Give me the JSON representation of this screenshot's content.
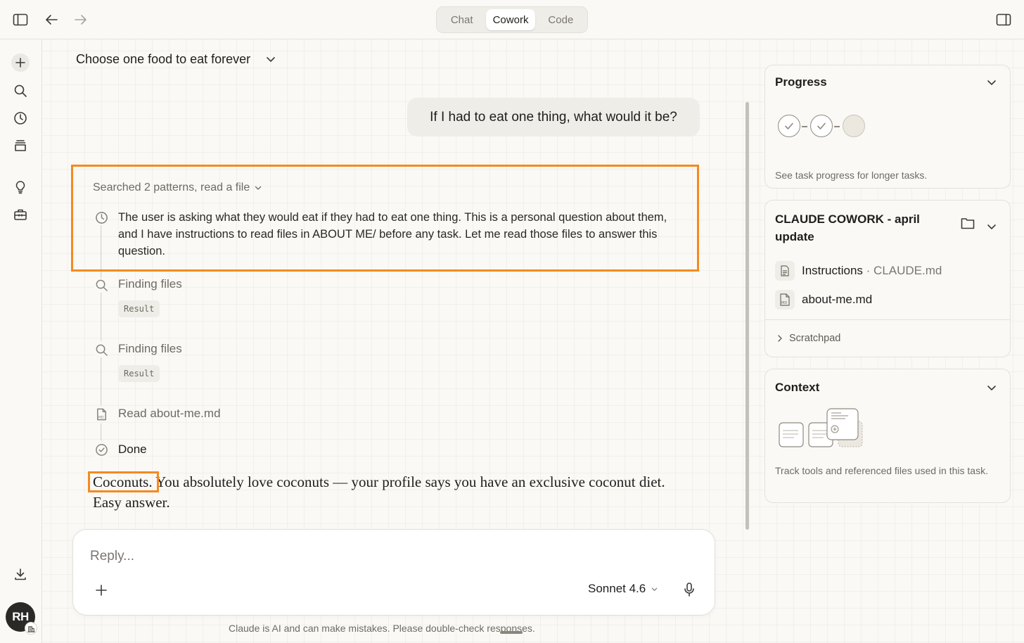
{
  "topbar": {
    "tabs": [
      {
        "label": "Chat",
        "active": false
      },
      {
        "label": "Cowork",
        "active": true
      },
      {
        "label": "Code",
        "active": false
      }
    ]
  },
  "rail": {
    "avatar_initials": "RH"
  },
  "conversation": {
    "title": "Choose one food to eat forever",
    "user_message": "If I had to eat one thing, what would it be?",
    "steps_summary": "Searched 2 patterns, read a file",
    "thinking": "The user is asking what they would eat if they had to eat one thing. This is a personal question about them, and I have instructions to read files in ABOUT ME/ before any task. Let me read those files to answer this question.",
    "steps": [
      {
        "label": "Finding files",
        "result": "Result"
      },
      {
        "label": "Finding files",
        "result": "Result"
      },
      {
        "label": "Read about-me.md"
      },
      {
        "label": "Done"
      }
    ],
    "answer_lead": "Coconuts.",
    "answer_rest": " You absolutely love coconuts — your profile says you have an exclusive coconut diet. Easy answer."
  },
  "composer": {
    "placeholder": "Reply...",
    "model": "Sonnet 4.6",
    "disclaimer": "Claude is AI and can make mistakes. Please double-check responses."
  },
  "panels": {
    "progress": {
      "title": "Progress",
      "note": "See task progress for longer tasks.",
      "steps_done": 2,
      "steps_total": 3
    },
    "project": {
      "title": "CLAUDE COWORK - april update",
      "files": [
        {
          "name": "Instructions",
          "sep": " · ",
          "sub": "CLAUDE.md"
        },
        {
          "name": "about-me.md"
        }
      ],
      "scratchpad": "Scratchpad"
    },
    "context": {
      "title": "Context",
      "note": "Track tools and referenced files used in this task."
    }
  },
  "colors": {
    "highlight": "#f58a1f",
    "background": "#faf9f6"
  }
}
